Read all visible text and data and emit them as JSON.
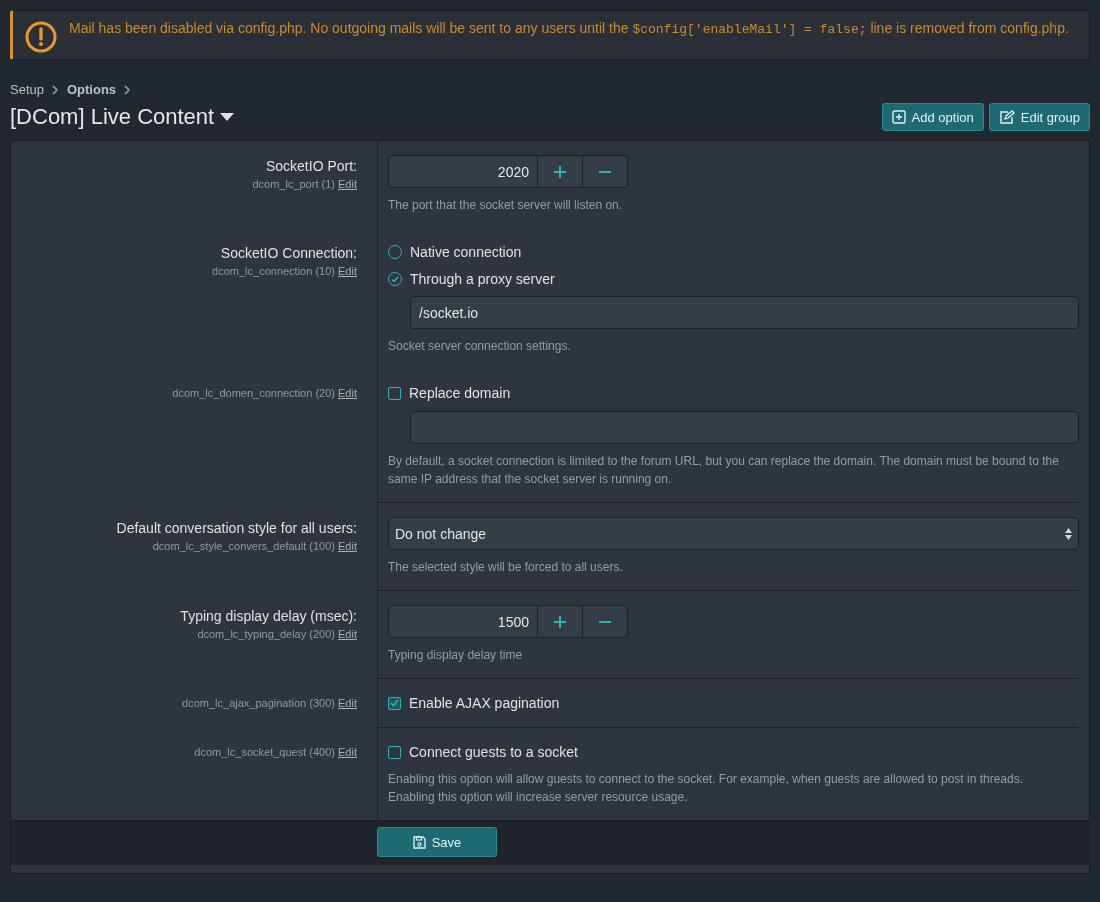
{
  "alert": {
    "segments": [
      {
        "kind": "text",
        "text": "Mail has been disabled via config.php. No outgoing mails will be sent to any users until the "
      },
      {
        "kind": "code",
        "text": "$config['enableMail'] = false;"
      },
      {
        "kind": "text",
        "text": " line is removed from config.php."
      }
    ]
  },
  "breadcrumb": [
    {
      "label": "Setup",
      "current": false
    },
    {
      "label": "Options",
      "current": true
    }
  ],
  "title": "[DCom] Live Content",
  "actions": [
    {
      "kind": "add",
      "label": "Add option"
    },
    {
      "kind": "edit",
      "label": "Edit group"
    }
  ],
  "groups": [
    [
      {
        "kind": "spinbox",
        "label": "SocketIO Port:",
        "key": "dcom_lc_port (1)",
        "edit": "Edit",
        "value": "2020",
        "hint": "The port that the socket server will listen on."
      },
      {
        "kind": "radio",
        "label": "SocketIO Connection:",
        "key": "dcom_lc_connection (10)",
        "edit": "Edit",
        "choices": [
          {
            "label": "Native connection",
            "selected": false
          },
          {
            "label": "Through a proxy server",
            "selected": true,
            "value": "/socket.io"
          }
        ],
        "hint": "Socket server connection settings."
      },
      {
        "kind": "checkbox",
        "key": "dcom_lc_domen_connection (20)",
        "edit": "Edit",
        "choice": "Replace domain",
        "checked": false,
        "has_input": true,
        "hint": "By default, a socket connection is limited to the forum URL, but you can replace the domain. The domain must be bound to the same IP address that the socket server is running on."
      }
    ],
    [
      {
        "kind": "select",
        "label": "Default conversation style for all users:",
        "key": "dcom_lc_style_convers_default (100)",
        "edit": "Edit",
        "value": "Do not change",
        "hint": "The selected style will be forced to all users."
      }
    ],
    [
      {
        "kind": "spinbox",
        "label": "Typing display delay (msec):",
        "key": "dcom_lc_typing_delay (200)",
        "edit": "Edit",
        "value": "1500",
        "hint": "Typing display delay time"
      }
    ],
    [
      {
        "kind": "checkbox",
        "key": "dcom_lc_ajax_pagination (300)",
        "edit": "Edit",
        "choice": "Enable AJAX pagination",
        "checked": true,
        "has_input": false
      }
    ],
    [
      {
        "kind": "checkbox",
        "key": "dcom_lc_socket_quest (400)",
        "edit": "Edit",
        "choice": "Connect guests to a socket",
        "checked": false,
        "has_input": false,
        "hint": "Enabling this option will allow guests to connect to the socket. For example, when guests are allowed to post in threads.\nEnabling this option will increase server resource usage."
      }
    ]
  ],
  "save": "Save"
}
